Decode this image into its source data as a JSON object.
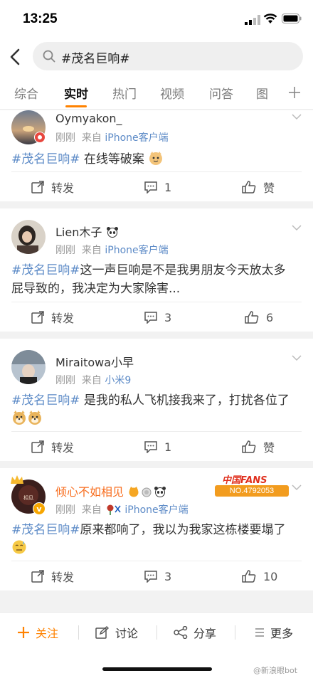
{
  "status": {
    "time": "13:25"
  },
  "search": {
    "query": "#茂名巨响#"
  },
  "tabs": [
    "综合",
    "实时",
    "热门",
    "视频",
    "问答",
    "图"
  ],
  "posts": [
    {
      "user": "Oymyakon_",
      "time": "刚刚",
      "from_prefix": "来自",
      "source": "iPhone客户端",
      "tag": "#茂名巨响#",
      "text": " 在线等破案",
      "repost": "转发",
      "comments": "1",
      "likes": "赞"
    },
    {
      "user": "Lien木子",
      "time": "刚刚",
      "from_prefix": "来自",
      "source": "iPhone客户端",
      "tag": "#茂名巨响#",
      "text_line1": "这一声巨响是不是我男朋友今天放太多",
      "text_line2": "屁导致的，我决定为大家除害...",
      "repost": "转发",
      "comments": "3",
      "likes": "6"
    },
    {
      "user": "Miraitowa小早",
      "time": "刚刚",
      "from_prefix": "来自",
      "source": "小米9",
      "tag": "#茂名巨响#",
      "text": " 是我的私人飞机接我来了，打扰各位了",
      "repost": "转发",
      "comments": "1",
      "likes": "赞"
    },
    {
      "user": "倾心不如相见",
      "time": "刚刚",
      "from_prefix": "来自",
      "source": "iPhone客户端",
      "tag": "#茂名巨响#",
      "text": "原来都响了，我以为我家这栋楼要塌了",
      "badge_title": "中国FANS",
      "badge_no": "NO.4792053",
      "repost": "转发",
      "comments": "3",
      "likes": "10"
    }
  ],
  "bottom": {
    "follow": "关注",
    "discuss": "讨论",
    "share": "分享",
    "more": "更多"
  },
  "watermark": "@新浪眼bot",
  "colors": {
    "accent": "#ff8200",
    "link": "#5d8bc7",
    "orange_name": "#f86e1f"
  }
}
